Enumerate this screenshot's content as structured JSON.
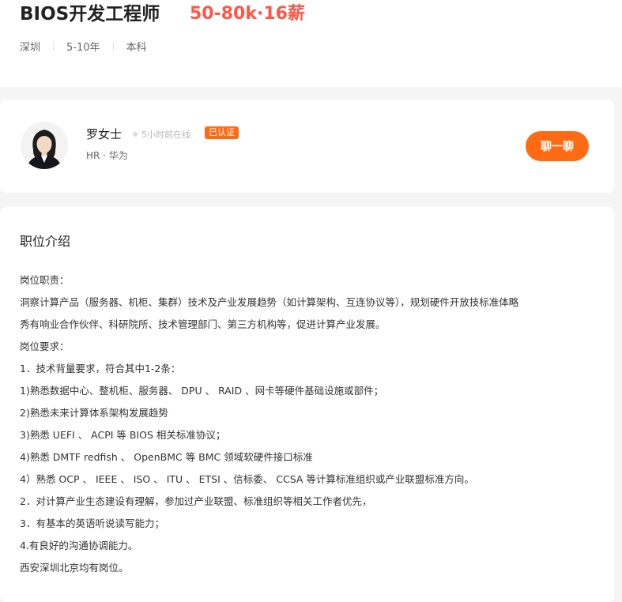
{
  "job": {
    "title": "BIOS开发工程师",
    "salary": "50-80k·16薪",
    "city": "深圳",
    "experience": "5-10年",
    "education": "本科"
  },
  "recruiter": {
    "avatar_icon": "person-portrait",
    "name": "罗女士",
    "online_status": "5小时前在线",
    "verified_label": "已认证",
    "company": "HR · 华为",
    "chat_label": "聊一聊"
  },
  "description": {
    "heading": "职位介绍",
    "lines": [
      "岗位职责：",
      "洞察计算产品（服务器、机柜、集群）技术及产业发展趋势（如计算架构、互连协议等），规划硬件开放技标准体略",
      "秀有响业合作伙伴、科研院所、技术管理部门、第三方机构等，促进计算产业发展。",
      "岗位要求：",
      "1．技术背量要求，符合其中1-2条：",
      "1)熟悉数据中心、整机柜、服务器、 DPU 、 RAID 、网卡等硬件基础设施或部件；",
      "2)熟悉未来计算体系架构发展趋势",
      "3)熟悉 UEFI 、 ACPI 等 BIOS 相关标准协议；",
      "4)熟悉 DMTF redfish 、 OpenBMC 等 BMC 领域软硬件接口标准",
      "4）熟悉 OCP 、 IEEE 、 ISO 、 ITU 、 ETSI 、信标委、 CCSA 等计算标准组织或产业联盟标准方向。",
      "2．对计算产业生态建设有理解，参加过产业联盟、标准组织等相关工作者优先，",
      "3．有基本的英语听说读写能力；",
      "4.有良好的沟通协调能力。",
      "西安深圳北京均有岗位。"
    ]
  },
  "colors": {
    "accent": "#ff6a13",
    "salary": "#fe574a",
    "page_bg": "#f5f5f5"
  }
}
